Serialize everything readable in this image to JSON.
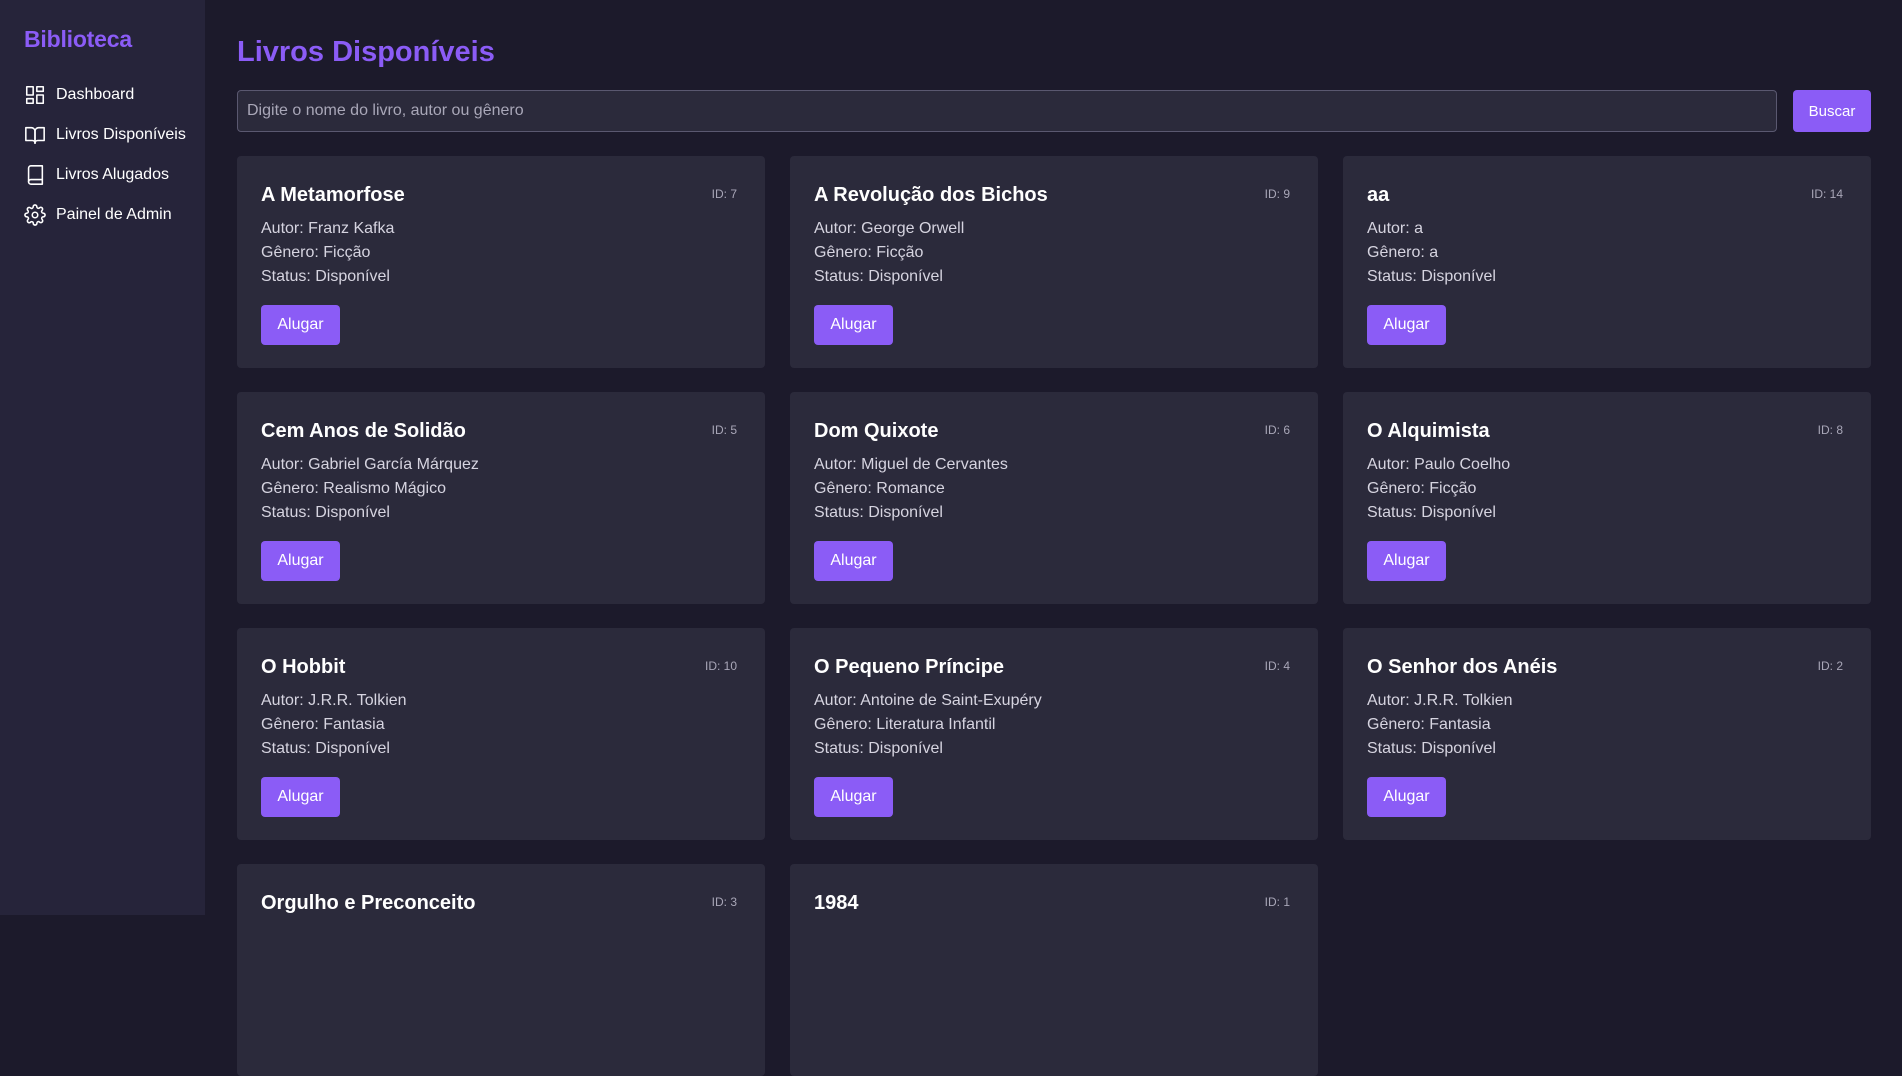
{
  "sidebar": {
    "brand": "Biblioteca",
    "items": [
      {
        "label": "Dashboard",
        "icon": "dashboard-icon"
      },
      {
        "label": "Livros Disponíveis",
        "icon": "open-book-icon"
      },
      {
        "label": "Livros Alugados",
        "icon": "book-icon"
      },
      {
        "label": "Painel de Admin",
        "icon": "gear-icon"
      }
    ]
  },
  "main": {
    "title": "Livros Disponíveis",
    "search": {
      "placeholder": "Digite o nome do livro, autor ou gênero",
      "value": "",
      "button_label": "Buscar"
    }
  },
  "books": [
    {
      "title": "A Metamorfose",
      "id": "ID: 7",
      "author": "Autor: Franz Kafka",
      "genre": "Gênero: Ficção",
      "status": "Status: Disponível",
      "action": "Alugar"
    },
    {
      "title": "A Revolução dos Bichos",
      "id": "ID: 9",
      "author": "Autor: George Orwell",
      "genre": "Gênero: Ficção",
      "status": "Status: Disponível",
      "action": "Alugar"
    },
    {
      "title": "aa",
      "id": "ID: 14",
      "author": "Autor: a",
      "genre": "Gênero: a",
      "status": "Status: Disponível",
      "action": "Alugar"
    },
    {
      "title": "Cem Anos de Solidão",
      "id": "ID: 5",
      "author": "Autor: Gabriel García Márquez",
      "genre": "Gênero: Realismo Mágico",
      "status": "Status: Disponível",
      "action": "Alugar"
    },
    {
      "title": "Dom Quixote",
      "id": "ID: 6",
      "author": "Autor: Miguel de Cervantes",
      "genre": "Gênero: Romance",
      "status": "Status: Disponível",
      "action": "Alugar"
    },
    {
      "title": "O Alquimista",
      "id": "ID: 8",
      "author": "Autor: Paulo Coelho",
      "genre": "Gênero: Ficção",
      "status": "Status: Disponível",
      "action": "Alugar"
    },
    {
      "title": "O Hobbit",
      "id": "ID: 10",
      "author": "Autor: J.R.R. Tolkien",
      "genre": "Gênero: Fantasia",
      "status": "Status: Disponível",
      "action": "Alugar"
    },
    {
      "title": "O Pequeno Príncipe",
      "id": "ID: 4",
      "author": "Autor: Antoine de Saint-Exupéry",
      "genre": "Gênero: Literatura Infantil",
      "status": "Status: Disponível",
      "action": "Alugar"
    },
    {
      "title": "O Senhor dos Anéis",
      "id": "ID: 2",
      "author": "Autor: J.R.R. Tolkien",
      "genre": "Gênero: Fantasia",
      "status": "Status: Disponível",
      "action": "Alugar"
    },
    {
      "title": "Orgulho e Preconceito",
      "id": "ID: 3"
    },
    {
      "title": "1984",
      "id": "ID: 1"
    }
  ],
  "colors": {
    "accent": "#8b5cf6",
    "background": "#1c1a2b",
    "sidebar": "#26243a",
    "card": "#2b2a3b"
  }
}
